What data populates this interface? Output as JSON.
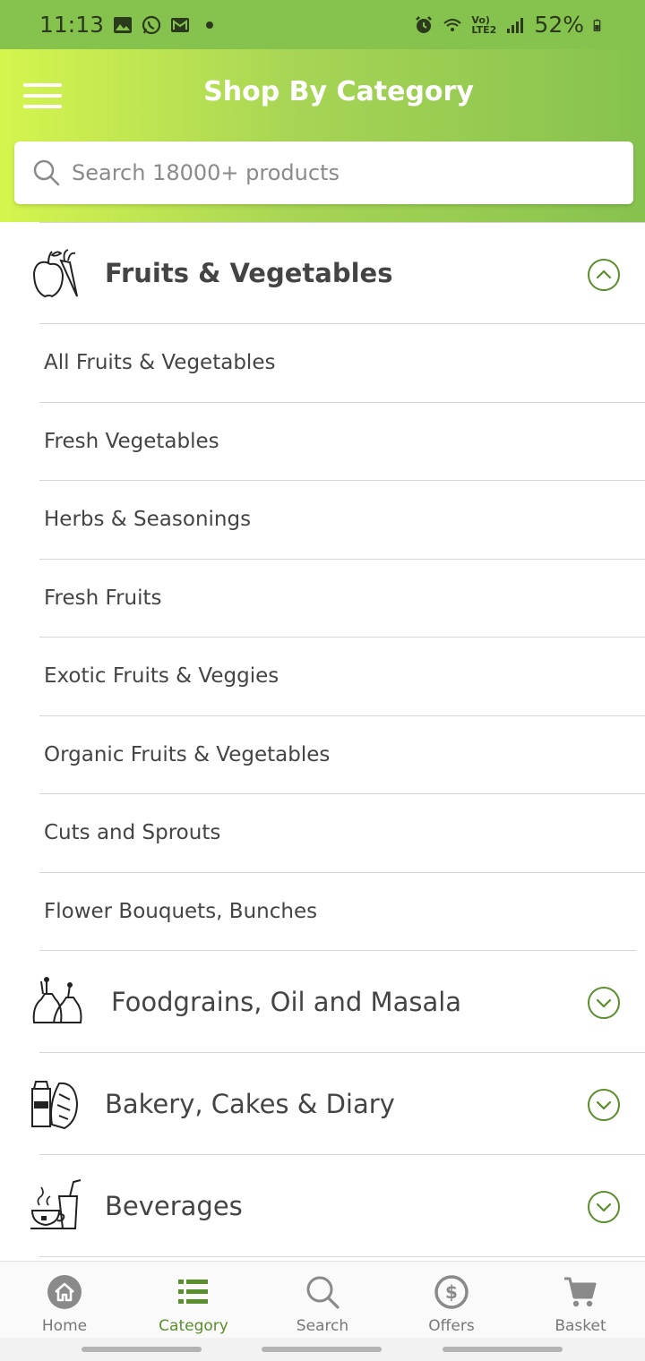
{
  "status_bar": {
    "time": "11:13",
    "battery": "52%",
    "network": "Vo) LTE2",
    "left_icons": [
      "gallery-icon",
      "whatsapp-icon",
      "mail-icon"
    ],
    "right_icons": [
      "alarm-icon",
      "wifi-icon",
      "signal-icon",
      "battery-icon"
    ]
  },
  "header": {
    "title": "Shop By Category",
    "search_placeholder": "Search 18000+ products",
    "background_gradient": [
      "#d5f54e",
      "#86c24e"
    ]
  },
  "categories": [
    {
      "label": "Fruits & Vegetables",
      "icon": "apple-carrot-icon",
      "expanded": true,
      "subcategories": [
        "All Fruits & Vegetables",
        "Fresh Vegetables",
        "Herbs & Seasonings",
        "Fresh Fruits",
        "Exotic Fruits & Veggies",
        "Organic Fruits & Vegetables",
        "Cuts and Sprouts",
        "Flower Bouquets, Bunches"
      ]
    },
    {
      "label": "Foodgrains, Oil and Masala",
      "icon": "grain-sacks-icon",
      "expanded": false
    },
    {
      "label": "Bakery, Cakes & Diary",
      "icon": "milk-bread-icon",
      "expanded": false
    },
    {
      "label": "Beverages",
      "icon": "tea-cup-icon",
      "expanded": false
    }
  ],
  "bottom_nav": [
    {
      "label": "Home",
      "icon": "home-icon",
      "active": false
    },
    {
      "label": "Category",
      "icon": "list-icon",
      "active": true
    },
    {
      "label": "Search",
      "icon": "search-icon",
      "active": false
    },
    {
      "label": "Offers",
      "icon": "offers-icon",
      "active": false
    },
    {
      "label": "Basket",
      "icon": "cart-icon",
      "active": false
    }
  ],
  "colors": {
    "accent": "#5a8d2b",
    "status_bar": "#86c24e",
    "text": "#444444",
    "divider": "#d6d6d6"
  }
}
